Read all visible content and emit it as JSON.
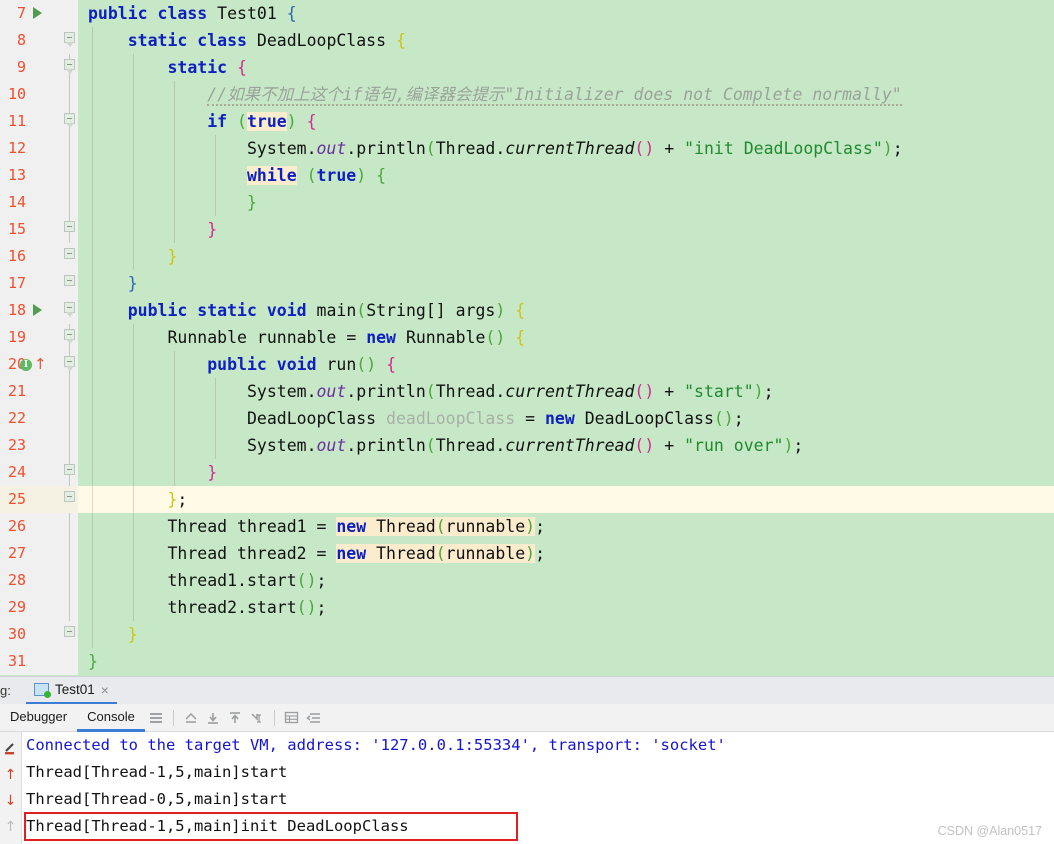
{
  "editor": {
    "background_hex": "#c7e8c7",
    "gutter_hex": "#f0f0f0",
    "caret_line_hex": "#fffae6",
    "lines": [
      {
        "no": "7",
        "marker": "run-gutter-icon",
        "fold": "none",
        "indent": 0
      },
      {
        "no": "8",
        "marker": "none",
        "fold": "start",
        "indent": 1
      },
      {
        "no": "9",
        "marker": "none",
        "fold": "start",
        "indent": 2
      },
      {
        "no": "10",
        "marker": "none",
        "fold": "none",
        "indent": 3
      },
      {
        "no": "11",
        "marker": "none",
        "fold": "start",
        "indent": 3
      },
      {
        "no": "12",
        "marker": "none",
        "fold": "none",
        "indent": 4
      },
      {
        "no": "13",
        "marker": "none",
        "fold": "none",
        "indent": 4
      },
      {
        "no": "14",
        "marker": "none",
        "fold": "none",
        "indent": 4
      },
      {
        "no": "15",
        "marker": "none",
        "fold": "end",
        "indent": 3
      },
      {
        "no": "16",
        "marker": "none",
        "fold": "end",
        "indent": 2
      },
      {
        "no": "17",
        "marker": "none",
        "fold": "end",
        "indent": 1
      },
      {
        "no": "18",
        "marker": "run-gutter-icon",
        "fold": "start",
        "indent": 1
      },
      {
        "no": "19",
        "marker": "none",
        "fold": "start",
        "indent": 2
      },
      {
        "no": "20",
        "marker": "impl-gutter-icon",
        "fold": "start",
        "indent": 3
      },
      {
        "no": "21",
        "marker": "none",
        "fold": "none",
        "indent": 4
      },
      {
        "no": "22",
        "marker": "none",
        "fold": "none",
        "indent": 4
      },
      {
        "no": "23",
        "marker": "none",
        "fold": "none",
        "indent": 4
      },
      {
        "no": "24",
        "marker": "none",
        "fold": "end",
        "indent": 3
      },
      {
        "no": "25",
        "marker": "none",
        "fold": "end",
        "indent": 2
      },
      {
        "no": "26",
        "marker": "none",
        "fold": "none",
        "indent": 2
      },
      {
        "no": "27",
        "marker": "none",
        "fold": "none",
        "indent": 2
      },
      {
        "no": "28",
        "marker": "none",
        "fold": "none",
        "indent": 2
      },
      {
        "no": "29",
        "marker": "none",
        "fold": "none",
        "indent": 2
      },
      {
        "no": "30",
        "marker": "none",
        "fold": "end",
        "indent": 1
      },
      {
        "no": "31",
        "marker": "none",
        "fold": "none",
        "indent": 0
      }
    ],
    "source_text": [
      "public class Test01 {",
      "    static class DeadLoopClass {",
      "        static {",
      "            //如果不加上这个if语句,编译器会提示\"Initializer does not Complete normally\"",
      "            if (true) {",
      "                System.out.println(Thread.currentThread() + \"init DeadLoopClass\");",
      "                while (true) {",
      "                }",
      "            }",
      "        }",
      "    }",
      "    public static void main(String[] args) {",
      "        Runnable runnable = new Runnable() {",
      "            public void run() {",
      "                System.out.println(Thread.currentThread() + \"start\");",
      "                DeadLoopClass deadLoopClass = new DeadLoopClass();",
      "                System.out.println(Thread.currentThread() + \"run over\");",
      "            }",
      "        };",
      "        Thread thread1 = new Thread(runnable);",
      "        Thread thread2 = new Thread(runnable);",
      "        thread1.start();",
      "        thread2.start();",
      "    }",
      "}"
    ],
    "caret_line_number": "25",
    "comment_text": "//如果不加上这个if语句,编译器会提示\"Initializer does not Complete normally\"",
    "highlighted_tokens": [
      "true",
      "while",
      "new"
    ]
  },
  "bottom_panel": {
    "tabstrip": {
      "prefix_label": "g:",
      "run_tab_label": "Test01",
      "close_label": "×"
    },
    "subbar": {
      "tabs": [
        {
          "label": "Debugger",
          "active": false
        },
        {
          "label": "Console",
          "active": true
        }
      ],
      "icons": [
        "menu-icon",
        "soft-wrap-icon",
        "scroll-to-end-icon",
        "scroll-to-top-icon",
        "print-icon",
        "table-icon",
        "settings-icon"
      ]
    },
    "console_gutter_icons": [
      "highlight-pen-icon",
      "previous-occurrence-icon",
      "next-occurrence-icon",
      "soft-wrap-up-icon"
    ],
    "console_lines": [
      {
        "text": "Connected to the target VM, address: '127.0.0.1:55334', transport: 'socket'",
        "color": "blue",
        "boxed": false
      },
      {
        "text": "Thread[Thread-1,5,main]start",
        "color": "black",
        "boxed": false
      },
      {
        "text": "Thread[Thread-0,5,main]start",
        "color": "black",
        "boxed": false
      },
      {
        "text": "Thread[Thread-1,5,main]init DeadLoopClass",
        "color": "black",
        "boxed": true
      }
    ],
    "highlight_box_color": "#e02020"
  },
  "watermark": "CSDN @Alan0517"
}
